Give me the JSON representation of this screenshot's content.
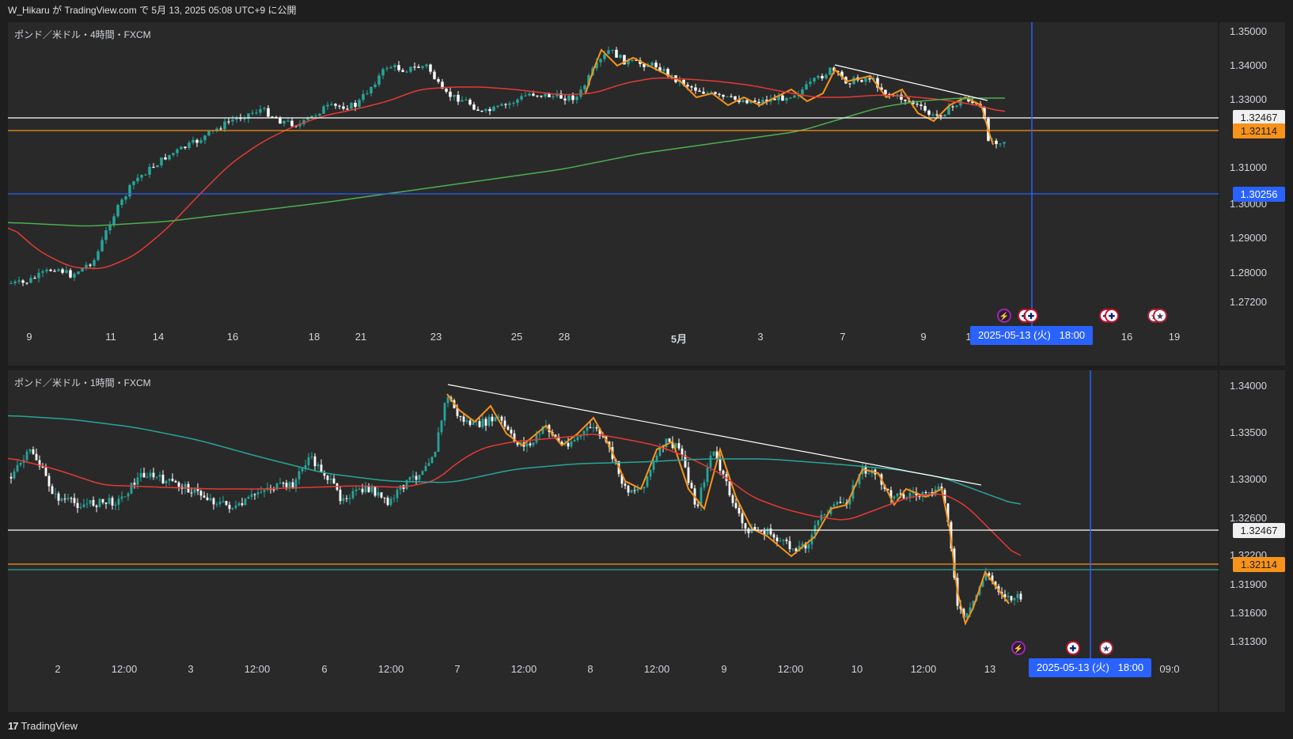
{
  "header": {
    "publish_info": "W_Hikaru が TradingView.com で 5月 13, 2025 05:08 UTC+9 に公開"
  },
  "footer": {
    "brand": "TradingView",
    "logo_text": "17"
  },
  "panes": [
    {
      "title": "ポンド／米ドル・4時間・FXCM",
      "price_axis": [
        "1.35000",
        "1.34000",
        "1.33000",
        "1.31000",
        "1.30000",
        "1.29000",
        "1.28000",
        "1.27200"
      ],
      "tags": {
        "white": "1.32467",
        "orange": "1.32114",
        "blue": "1.30256"
      },
      "time_axis": [
        "9",
        "11",
        "14",
        "16",
        "18",
        "21",
        "23",
        "25",
        "28",
        "5月",
        "3",
        "7",
        "9",
        "1",
        "16",
        "19"
      ],
      "crosshair_date": "2025-05-13 (火)   18:00",
      "events": [
        "flash",
        "uk",
        "uk",
        "uk",
        "uk",
        "us",
        "us"
      ]
    },
    {
      "title": "ポンド／米ドル・1時間・FXCM",
      "price_axis": [
        "1.34000",
        "1.33500",
        "1.33000",
        "1.32600",
        "1.32200",
        "1.31900",
        "1.31600",
        "1.31300"
      ],
      "tags": {
        "white": "1.32467",
        "orange": "1.32114"
      },
      "time_axis": [
        "2",
        "12:00",
        "3",
        "12:00",
        "6",
        "12:00",
        "7",
        "12:00",
        "8",
        "12:00",
        "9",
        "12:00",
        "10",
        "12:00",
        "13",
        "09:0"
      ],
      "crosshair_date": "2025-05-13 (火)   18:00",
      "events": [
        "flash",
        "uk",
        "us"
      ]
    }
  ],
  "colors": {
    "background": "#1e1e1e",
    "pane": "#292929",
    "up": "#26a69a",
    "down": "#ffffff",
    "ma_red": "#e53935",
    "ma_green": "#4caf50",
    "ma_teal": "#26a69a",
    "zigzag": "#f7931a",
    "crosshair": "#2962ff",
    "level_white": "#ffffff",
    "level_orange": "#f7931a",
    "level_blue": "#2962ff"
  }
}
